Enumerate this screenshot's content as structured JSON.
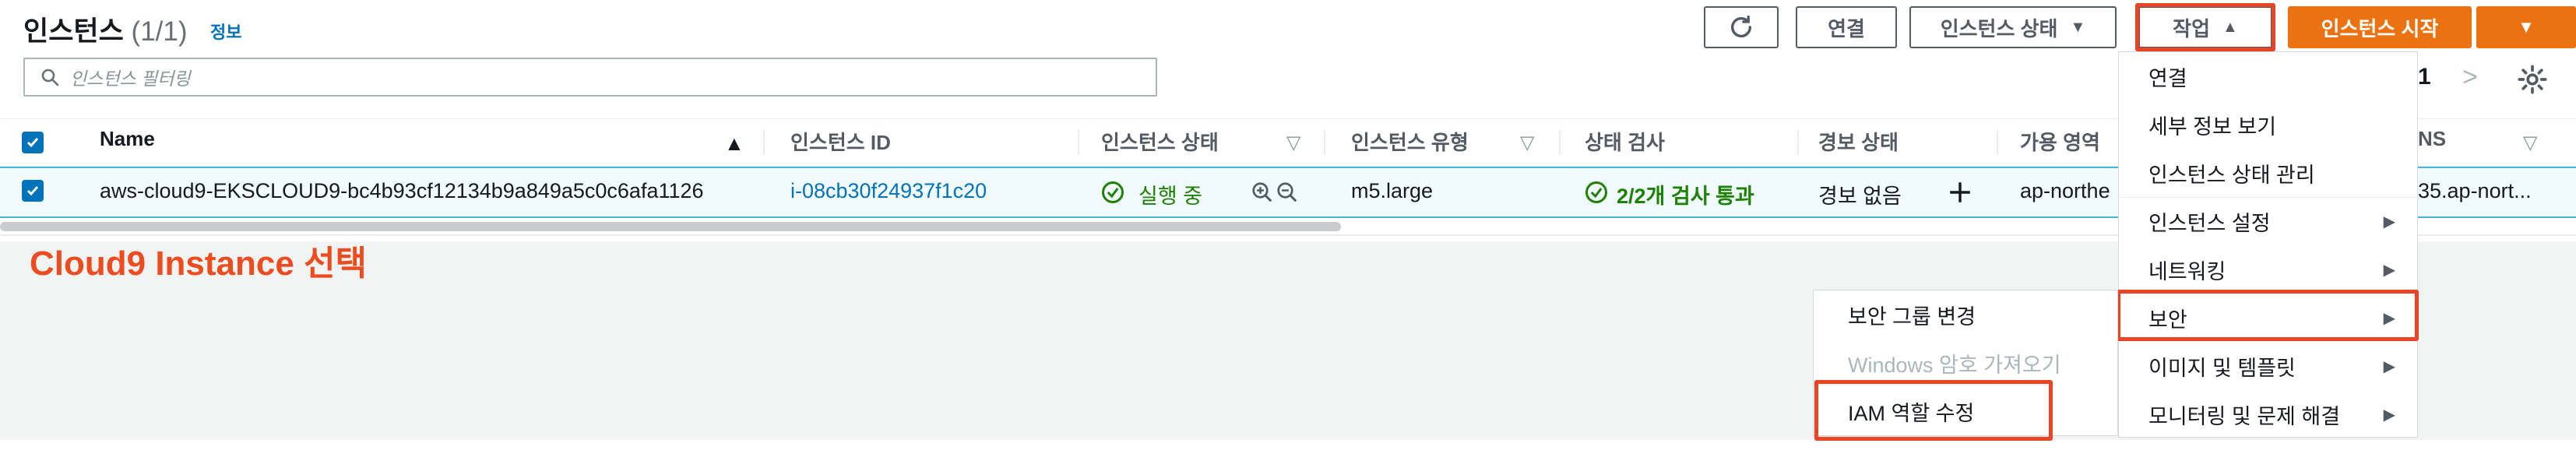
{
  "header": {
    "title": "인스턴스",
    "count": "(1/1)",
    "info_link": "정보",
    "buttons": {
      "refresh_icon": "refresh-icon",
      "connect": "연결",
      "instance_state": "인스턴스 상태",
      "actions": "작업",
      "launch": "인스턴스 시작"
    }
  },
  "search": {
    "placeholder": "인스턴스 필터링",
    "icon": "search-icon"
  },
  "pagination": {
    "page": "1"
  },
  "table": {
    "columns": [
      "Name",
      "인스턴스 ID",
      "인스턴스 상태",
      "인스턴스 유형",
      "상태 검사",
      "경보 상태",
      "가용 영역",
      "NS"
    ],
    "rows": [
      {
        "name": "aws-cloud9-EKSCLOUD9-bc4b93cf12134b9a849a5c0c6afa1126",
        "instance_id": "i-08cb30f24937f1c20",
        "state": "실행 중",
        "type": "m5.large",
        "status_check": "2/2개 검사 통과",
        "alarm": "경보 없음",
        "az": "ap-northe",
        "dns": "35.ap-nort..."
      }
    ]
  },
  "annotation": "Cloud9 Instance 선택",
  "actions_menu": {
    "items": [
      "연결",
      "세부 정보 보기",
      "인스턴스 상태 관리",
      "인스턴스 설정",
      "네트워킹",
      "보안",
      "이미지 및 템플릿",
      "모니터링 및 문제 해결"
    ]
  },
  "security_submenu": {
    "items": [
      "보안 그룹 변경",
      "Windows 암호 가져오기",
      "IAM 역할 수정"
    ]
  },
  "colors": {
    "primary": "#ec7211",
    "link": "#0073bb",
    "success": "#1d8102",
    "highlight": "#e94524",
    "annotation": "#ee4c1e"
  }
}
